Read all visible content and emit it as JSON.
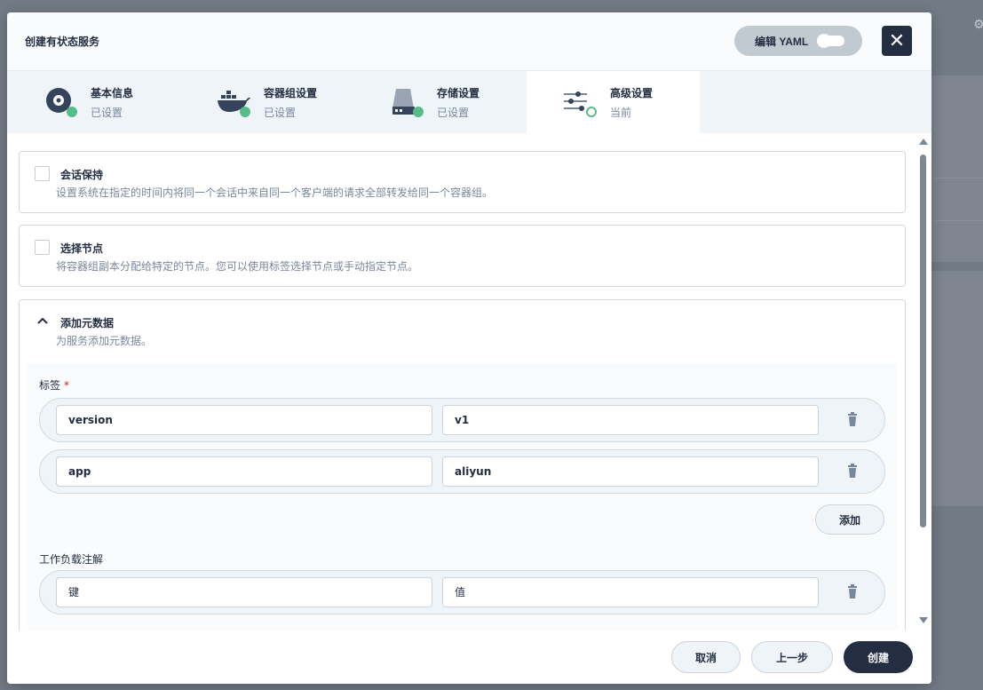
{
  "modal": {
    "title": "创建有状态服务",
    "yaml_button": "编辑 YAML",
    "close_symbol": "✕"
  },
  "steps": [
    {
      "title": "基本信息",
      "status": "已设置",
      "icon": "disk-icon"
    },
    {
      "title": "容器组设置",
      "status": "已设置",
      "icon": "docker-icon"
    },
    {
      "title": "存储设置",
      "status": "已设置",
      "icon": "storage-icon"
    },
    {
      "title": "高级设置",
      "status": "当前",
      "icon": "sliders-icon"
    }
  ],
  "sections": {
    "session": {
      "title": "会话保持",
      "description": "设置系统在指定的时间内将同一个会话中来自同一个客户端的请求全部转发给同一个容器组。"
    },
    "node": {
      "title": "选择节点",
      "description": "将容器组副本分配给特定的节点。您可以使用标签选择节点或手动指定节点。"
    },
    "metadata": {
      "title": "添加元数据",
      "description": "为服务添加元数据。",
      "labels_title": "标签",
      "required_mark": "*",
      "labels": [
        {
          "key": "version",
          "value": "v1"
        },
        {
          "key": "app",
          "value": "aliyun"
        }
      ],
      "add_label": "添加",
      "annotations_title": "工作负载注解",
      "annotation_key_placeholder": "键",
      "annotation_value_placeholder": "值"
    }
  },
  "footer": {
    "cancel": "取消",
    "previous": "上一步",
    "create": "创建"
  },
  "colors": {
    "primary_dark": "#242e42",
    "success": "#55bc8a",
    "required": "#ca2621",
    "step_bg": "#eff4f9"
  }
}
